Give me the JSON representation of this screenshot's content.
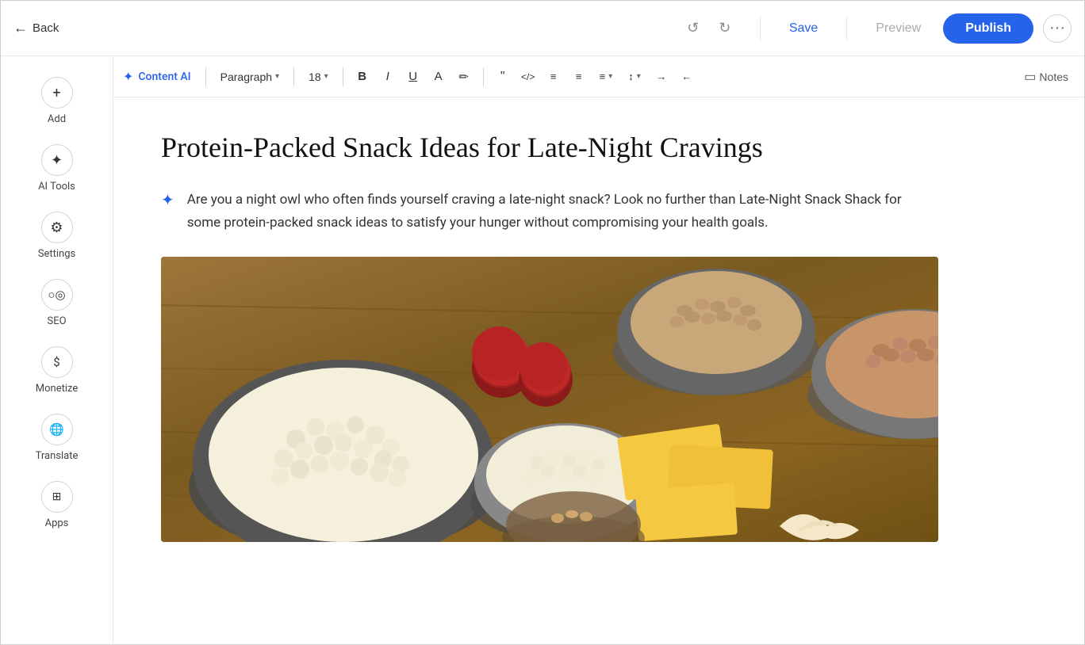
{
  "header": {
    "back_label": "Back",
    "save_label": "Save",
    "preview_label": "Preview",
    "publish_label": "Publish"
  },
  "toolbar": {
    "ai_label": "Content AI",
    "paragraph_label": "Paragraph",
    "font_size": "18",
    "notes_label": "Notes"
  },
  "sidebar": {
    "items": [
      {
        "id": "add",
        "label": "Add",
        "icon": "+"
      },
      {
        "id": "ai-tools",
        "label": "AI Tools",
        "icon": "✦"
      },
      {
        "id": "settings",
        "label": "Settings",
        "icon": "⚙"
      },
      {
        "id": "seo",
        "label": "SEO",
        "icon": "🔍"
      },
      {
        "id": "monetize",
        "label": "Monetize",
        "icon": "💲"
      },
      {
        "id": "translate",
        "label": "Translate",
        "icon": "🌐"
      },
      {
        "id": "apps",
        "label": "Apps",
        "icon": "⊞"
      }
    ]
  },
  "article": {
    "title": "Protein-Packed Snack Ideas for Late-Night Cravings",
    "intro": "Are you a night owl who often finds yourself craving a late-night snack? Look no further than Late-Night Snack Shack for some protein-packed snack ideas to satisfy your hunger without compromising your health goals."
  }
}
